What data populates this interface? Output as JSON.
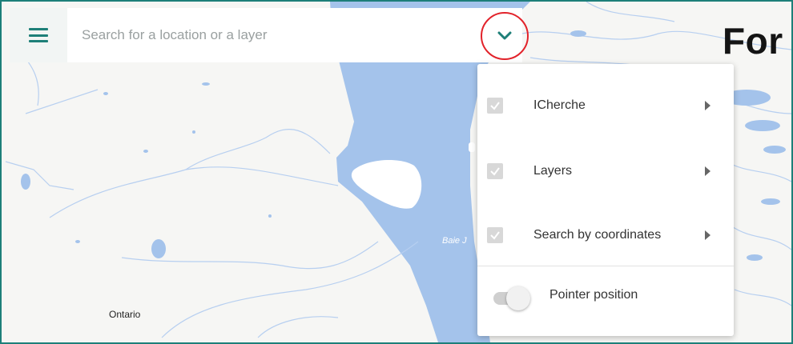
{
  "search": {
    "placeholder": "Search for a location or a layer"
  },
  "icons": {
    "menu": "menu-icon",
    "chevron": "chevron-down-icon",
    "submenu_arrow": "caret-right-icon",
    "check": "check-icon"
  },
  "colors": {
    "accent": "#1e7f78",
    "highlight": "#e2232b",
    "water": "#a4c3eb",
    "land": "#f6f6f4"
  },
  "map": {
    "title_partial": "For",
    "place_label": "Ontario",
    "water_label": "Baie J"
  },
  "dropdown": {
    "items": [
      {
        "label": "ICherche",
        "checked": true
      },
      {
        "label": "Layers",
        "checked": true
      },
      {
        "label": "Search by coordinates",
        "checked": true
      }
    ],
    "toggle": {
      "label": "Pointer position",
      "on": false
    }
  }
}
